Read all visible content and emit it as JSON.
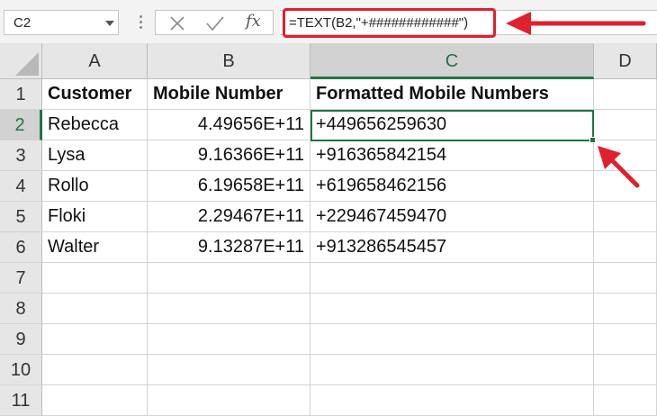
{
  "name_box": {
    "value": "C2"
  },
  "formula_bar": {
    "formula": "=TEXT(B2,\"+############\")",
    "fx_label": "fx"
  },
  "columns": [
    "A",
    "B",
    "C",
    "D"
  ],
  "rows": [
    "1",
    "2",
    "3",
    "4",
    "5",
    "6",
    "7",
    "8",
    "9",
    "10",
    "11"
  ],
  "table": {
    "headers": [
      "Customer",
      "Mobile Number",
      "Formatted Mobile Numbers"
    ],
    "data": [
      [
        "Rebecca",
        "4.49656E+11",
        "+449656259630"
      ],
      [
        "Lysa",
        "9.16366E+11",
        "+916365842154"
      ],
      [
        "Rollo",
        "6.19658E+11",
        "+619658462156"
      ],
      [
        "Floki",
        "2.29467E+11",
        "+229467459470"
      ],
      [
        "Walter",
        "9.13287E+11",
        "+913286545457"
      ]
    ]
  },
  "colors": {
    "accent": "#217346",
    "annotation": "#e0202c"
  }
}
